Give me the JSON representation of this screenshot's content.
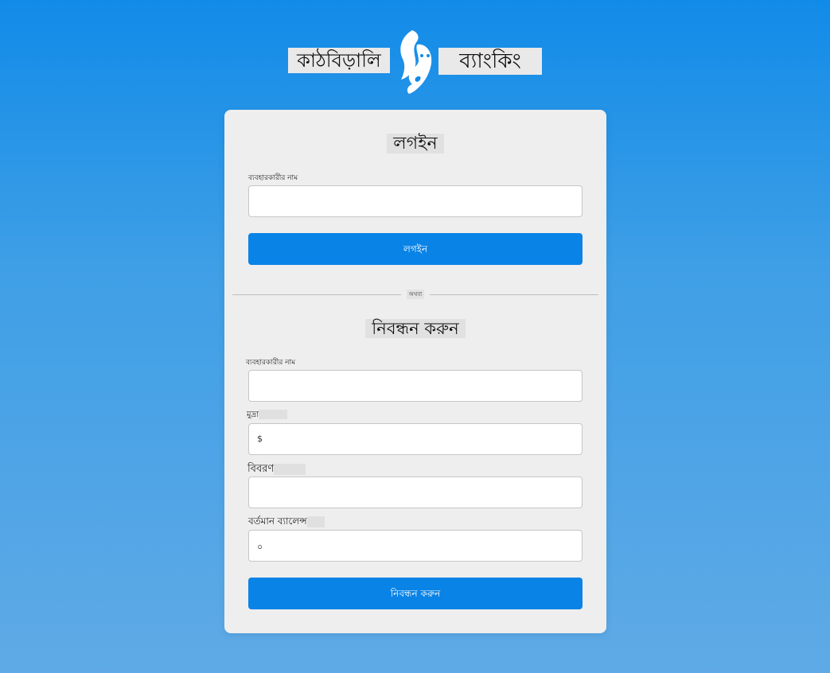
{
  "brand": {
    "name_left": "কাঠবিড়ালি",
    "name_right": "ব্যাংকিং",
    "logo_icon": "squirrel-icon"
  },
  "login": {
    "title": "লগইন",
    "username_label": "ব্যবহারকারীর নাম",
    "username_value": "",
    "submit_label": "লগইন"
  },
  "divider": {
    "text": "অথবা"
  },
  "register": {
    "title": "নিবন্ধন করুন",
    "username_label": "ব্যবহারকারীর নাম",
    "username_value": "",
    "currency_label": "মুদ্রা",
    "currency_value": "$",
    "description_label": "বিবরণ",
    "description_value": "",
    "balance_label": "বর্তমান ব্যালেন্স",
    "balance_value": "০",
    "submit_label": "নিবন্ধন করুন"
  },
  "colors": {
    "background_top": "#118be8",
    "background_bottom": "#5faae6",
    "card": "#eeeeee",
    "button": "#0a83e6"
  }
}
